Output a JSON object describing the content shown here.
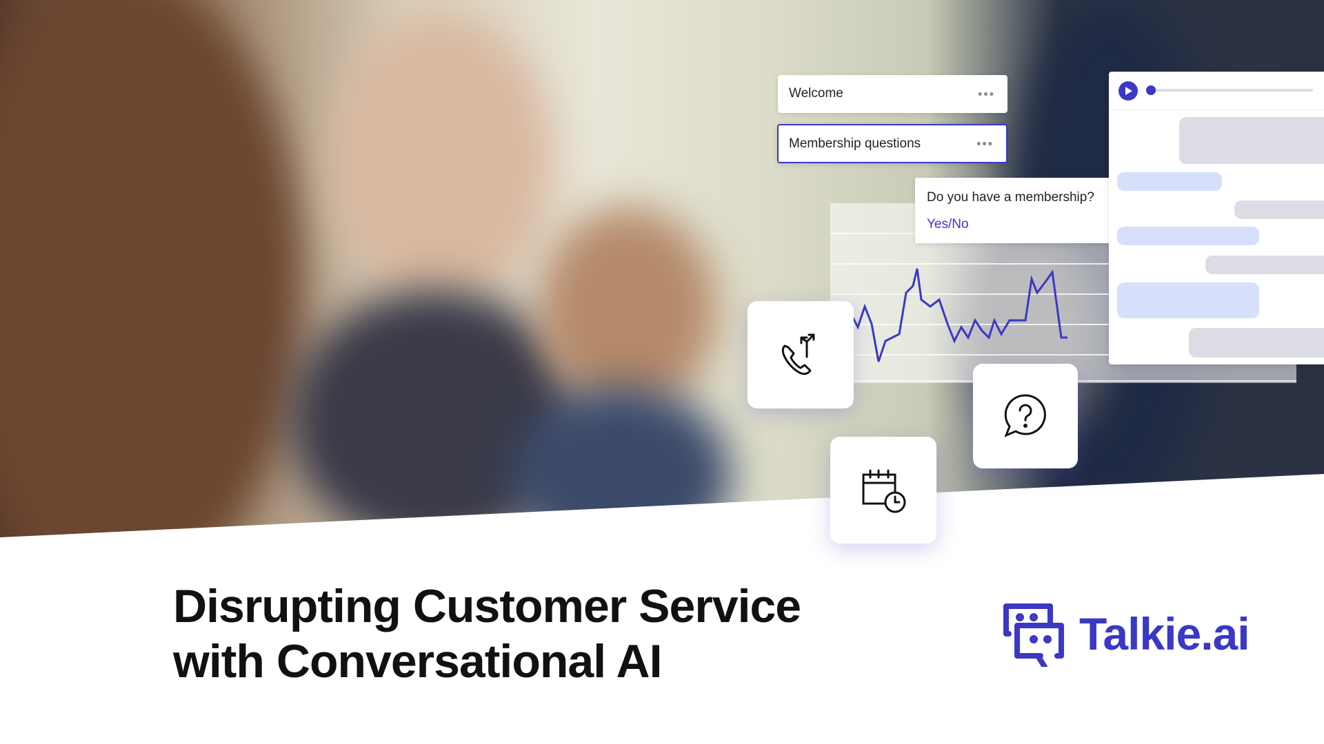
{
  "flow_cards": [
    {
      "label": "Welcome",
      "menu": "•••"
    },
    {
      "label": "Membership questions",
      "menu": "•••"
    }
  ],
  "question_card": {
    "question": "Do you have a membership?",
    "answer": "Yes/No"
  },
  "icons": [
    "phone-transfer-icon",
    "question-bubble-icon",
    "calendar-clock-icon",
    "play-icon"
  ],
  "headline": {
    "line1": "Disrupting Customer Service",
    "line2": "with Conversational AI"
  },
  "logo": {
    "text": "Talkie.ai"
  },
  "colors": {
    "accent": "#3a38c4",
    "bubble_user": "#d6e0fb",
    "bubble_bot": "#dcdde4"
  }
}
